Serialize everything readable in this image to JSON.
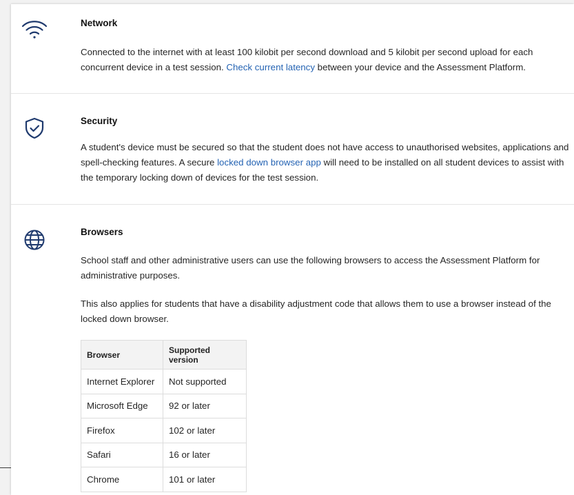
{
  "network": {
    "icon": "wifi-icon",
    "title": "Network",
    "text_before": "Connected to the internet with at least 100 kilobit per second download and 5 kilobit per second upload for each concurrent device in a test session. ",
    "link": "Check current latency",
    "text_after": " between your device and the Assessment Platform."
  },
  "security": {
    "icon": "shield-check-icon",
    "title": "Security",
    "text_before": "A student's device must be secured so that the student does not have access to unauthorised websites, applications and spell-checking features. A secure ",
    "link": "locked down browser app",
    "text_after": " will need to be installed on all student devices to assist with the temporary locking down of devices for the test session."
  },
  "browsers": {
    "icon": "globe-icon",
    "title": "Browsers",
    "para1": "School staff and other administrative users can use the following browsers to access the Assessment Platform for administrative purposes.",
    "para2": "This also applies for students that have a disability adjustment code that allows them to use a browser instead of the locked down browser.",
    "table": {
      "headers": [
        "Browser",
        "Supported version"
      ],
      "rows": [
        [
          "Internet Explorer",
          "Not supported"
        ],
        [
          "Microsoft Edge",
          "92 or later"
        ],
        [
          "Firefox",
          "102 or later"
        ],
        [
          "Safari",
          "16 or later"
        ],
        [
          "Chrome",
          "101 or later"
        ]
      ]
    }
  },
  "colors": {
    "icon": "#1f3a6e",
    "link": "#2463b3",
    "divider": "#e4e4e4"
  }
}
